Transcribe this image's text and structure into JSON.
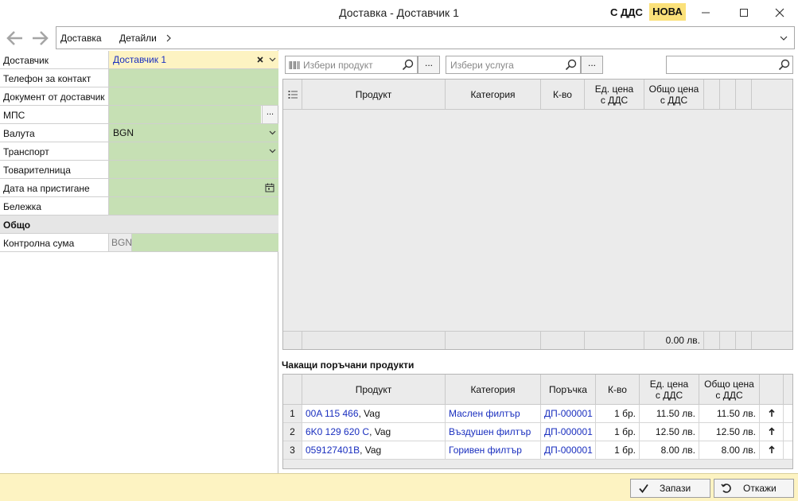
{
  "window": {
    "title": "Доставка - Доставчик 1",
    "vat_label": "С ДДС",
    "status_badge": "НОВА"
  },
  "nav": {
    "breadcrumb": [
      "Доставка",
      "Детайли"
    ]
  },
  "form": {
    "supplier_label": "Доставчик",
    "supplier_value": "Доставчик 1",
    "phone_label": "Телефон за контакт",
    "document_label": "Документ от доставчик",
    "mps_label": "МПС",
    "currency_label": "Валута",
    "currency_value": "BGN",
    "transport_label": "Транспорт",
    "waybill_label": "Товарителница",
    "arrival_label": "Дата на пристигане",
    "note_label": "Бележка",
    "section_total": "Общо",
    "checksum_label": "Контролна сума",
    "checksum_currency": "BGN",
    "ellipsis": "..."
  },
  "search": {
    "product_placeholder": "Избери продукт",
    "service_placeholder": "Избери услуга",
    "ellipsis": "..."
  },
  "items_grid": {
    "columns": [
      "Продукт",
      "Категория",
      "К-во",
      "Ед. цена\nс ДДС",
      "Общо цена\nс ДДС"
    ],
    "total": "0.00 лв."
  },
  "pending": {
    "title": "Чакащи поръчани продукти",
    "columns": [
      "Продукт",
      "Категория",
      "Поръчка",
      "К-во",
      "Ед. цена\nс ДДС",
      "Общо цена\nс ДДС"
    ],
    "rows": [
      {
        "n": "1",
        "code": "00A 115 466",
        "brand": ", Vag",
        "category": "Маслен филтър",
        "order": "ДП-000001",
        "qty": "1 бр.",
        "unit": "11.50 лв.",
        "total": "11.50 лв."
      },
      {
        "n": "2",
        "code": "6K0 129 620 C",
        "brand": ", Vag",
        "category": "Въздушен филтър",
        "order": "ДП-000001",
        "qty": "1 бр.",
        "unit": "12.50 лв.",
        "total": "12.50 лв."
      },
      {
        "n": "3",
        "code": "059127401B",
        "brand": ", Vag",
        "category": "Горивен филтър",
        "order": "ДП-000001",
        "qty": "1 бр.",
        "unit": "8.00 лв.",
        "total": "8.00 лв."
      }
    ]
  },
  "actions": {
    "save_label": "Запази",
    "cancel_label": "Откажи"
  }
}
